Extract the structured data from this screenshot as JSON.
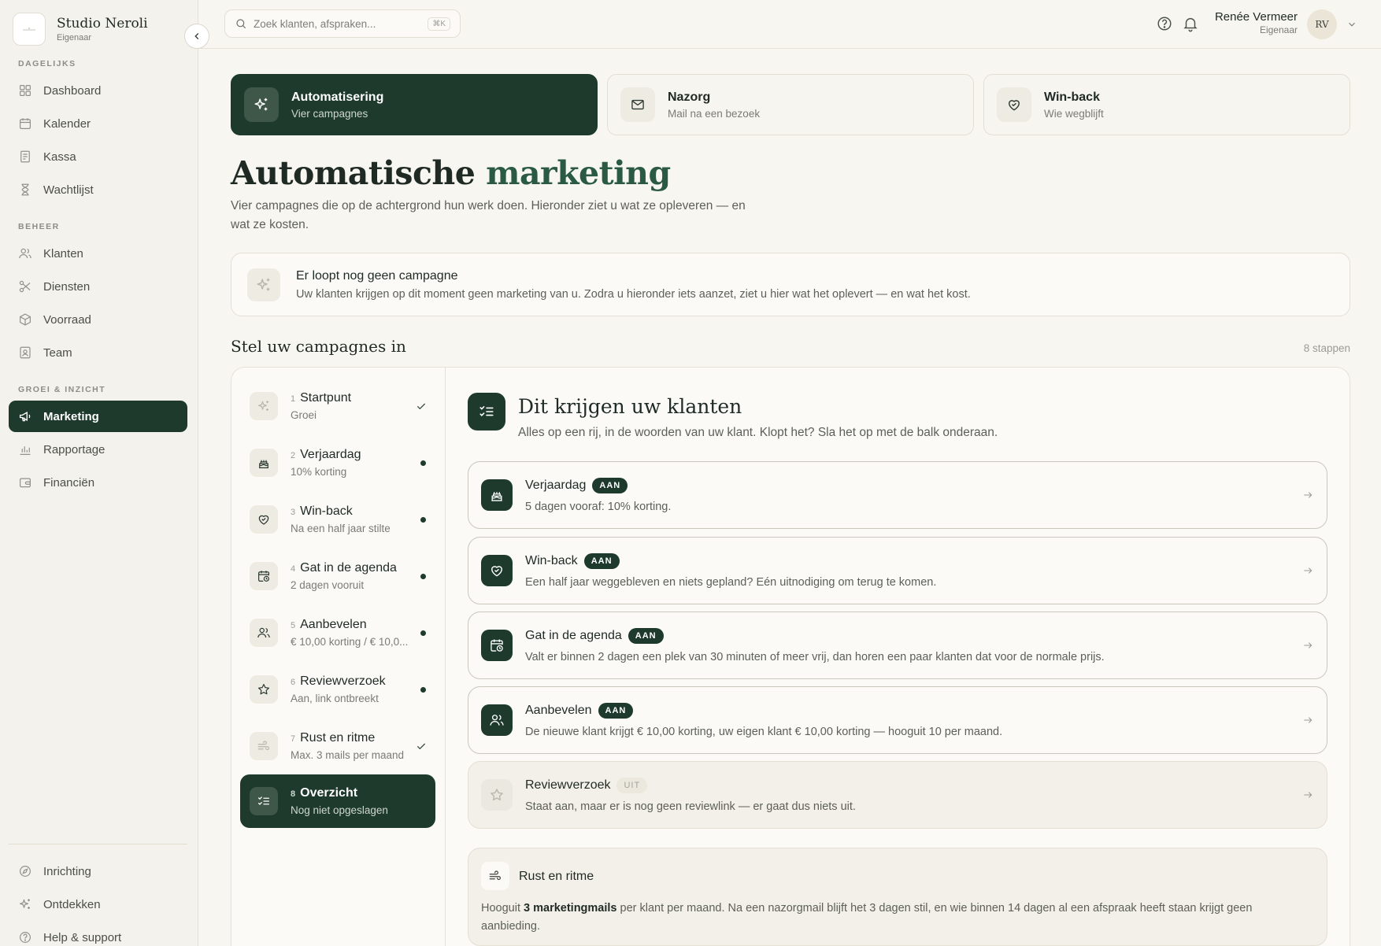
{
  "sidebar": {
    "brand_name": "Studio Neroli",
    "brand_role": "Eigenaar",
    "sections": [
      "DAGELIJKS",
      "BEHEER",
      "GROEI & INZICHT"
    ],
    "items": [
      {
        "label": "Dashboard",
        "icon": "grid-icon"
      },
      {
        "label": "Kalender",
        "icon": "calendar-icon"
      },
      {
        "label": "Kassa",
        "icon": "receipt-icon"
      },
      {
        "label": "Wachtlijst",
        "icon": "hourglass-icon"
      },
      {
        "label": "Klanten",
        "icon": "users-icon"
      },
      {
        "label": "Diensten",
        "icon": "scissors-icon"
      },
      {
        "label": "Voorraad",
        "icon": "box-icon"
      },
      {
        "label": "Team",
        "icon": "id-badge-icon"
      },
      {
        "label": "Marketing",
        "icon": "megaphone-icon"
      },
      {
        "label": "Rapportage",
        "icon": "bar-chart-icon"
      },
      {
        "label": "Financiën",
        "icon": "wallet-icon"
      },
      {
        "label": "Inrichting",
        "icon": "compass-icon"
      },
      {
        "label": "Ontdekken",
        "icon": "sparkles-icon"
      },
      {
        "label": "Help & support",
        "icon": "help-circle-icon"
      }
    ],
    "active_item": "Marketing"
  },
  "topbar": {
    "search_placeholder": "Zoek klanten, afspraken...",
    "search_shortcut": "⌘K",
    "user_name": "Renée Vermeer",
    "user_role": "Eigenaar",
    "avatar_initials": "RV"
  },
  "tabs": [
    {
      "title": "Automatisering",
      "sub": "Vier campagnes",
      "icon": "sparkles-icon",
      "active": true
    },
    {
      "title": "Nazorg",
      "sub": "Mail na een bezoek",
      "icon": "mail-icon",
      "active": false
    },
    {
      "title": "Win-back",
      "sub": "Wie wegblijft",
      "icon": "heart-handshake-icon",
      "active": false
    }
  ],
  "page": {
    "title_main": "Automatische",
    "title_accent": "marketing",
    "description": "Vier campagnes die op de achtergrond hun werk doen. Hieronder ziet u wat ze opleveren — en wat ze kosten."
  },
  "notice": {
    "title": "Er loopt nog geen campagne",
    "text": "Uw klanten krijgen op dit moment geen marketing van u. Zodra u hieronder iets aanzet, ziet u hier wat het oplevert — en wat het kost."
  },
  "setup": {
    "title": "Stel uw campagnes in",
    "steps_count": "8 stappen",
    "steps": [
      {
        "num": "1",
        "title": "Startpunt",
        "sub": "Groei",
        "status": "check",
        "icon": "sparkles-icon"
      },
      {
        "num": "2",
        "title": "Verjaardag",
        "sub": "10% korting",
        "status": "dot",
        "icon": "cake-icon"
      },
      {
        "num": "3",
        "title": "Win-back",
        "sub": "Na een half jaar stilte",
        "status": "dot",
        "icon": "heart-handshake-icon"
      },
      {
        "num": "4",
        "title": "Gat in de agenda",
        "sub": "2 dagen vooruit",
        "status": "dot",
        "icon": "calendar-clock-icon"
      },
      {
        "num": "5",
        "title": "Aanbevelen",
        "sub": "€ 10,00 korting / € 10,0...",
        "status": "dot",
        "icon": "users-icon"
      },
      {
        "num": "6",
        "title": "Reviewverzoek",
        "sub": "Aan, link ontbreekt",
        "status": "dot",
        "icon": "star-icon"
      },
      {
        "num": "7",
        "title": "Rust en ritme",
        "sub": "Max. 3 mails per maand",
        "status": "check",
        "icon": "wind-icon"
      },
      {
        "num": "8",
        "title": "Overzicht",
        "sub": "Nog niet opgeslagen",
        "status": "none",
        "icon": "list-checks-icon"
      }
    ]
  },
  "detail": {
    "title": "Dit krijgen uw klanten",
    "sub": "Alles op een rij, in de woorden van uw klant. Klopt het? Sla het op met de balk onderaan.",
    "campaigns": [
      {
        "title": "Verjaardag",
        "badge": "AAN",
        "desc": "5 dagen vooraf: 10% korting.",
        "icon": "cake-icon",
        "on": true
      },
      {
        "title": "Win-back",
        "badge": "AAN",
        "desc": "Een half jaar weggebleven en niets gepland? Eén uitnodiging om terug te komen.",
        "icon": "heart-handshake-icon",
        "on": true
      },
      {
        "title": "Gat in de agenda",
        "badge": "AAN",
        "desc": "Valt er binnen 2 dagen een plek van 30 minuten of meer vrij, dan horen een paar klanten dat voor de normale prijs.",
        "icon": "calendar-clock-icon",
        "on": true
      },
      {
        "title": "Aanbevelen",
        "badge": "AAN",
        "desc": "De nieuwe klant krijgt € 10,00 korting, uw eigen klant € 10,00 korting — hooguit 10 per maand.",
        "icon": "users-icon",
        "on": true
      },
      {
        "title": "Reviewverzoek",
        "badge": "UIT",
        "desc": "Staat aan, maar er is nog geen reviewlink — er gaat dus niets uit.",
        "icon": "star-icon",
        "on": false
      }
    ],
    "rhythm": {
      "title": "Rust en ritme",
      "text_pre": "Hooguit ",
      "text_bold": "3 marketingmails",
      "text_post": " per klant per maand. Na een nazorgmail blijft het 3 dagen stil, en wie binnen 14 dagen al een afspraak heeft staan krijgt geen aanbieding."
    }
  }
}
